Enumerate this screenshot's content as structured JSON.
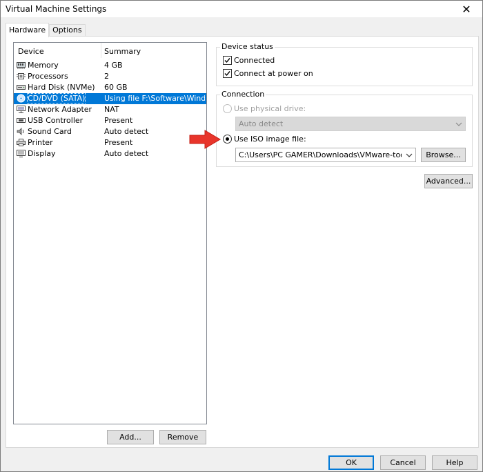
{
  "window": {
    "title": "Virtual Machine Settings",
    "close_icon": "close-icon"
  },
  "tabs": [
    {
      "label": "Hardware",
      "active": true
    },
    {
      "label": "Options",
      "active": false
    }
  ],
  "device_list": {
    "columns": [
      "Device",
      "Summary"
    ],
    "rows": [
      {
        "name": "Memory",
        "summary": "4 GB",
        "icon": "memory-icon",
        "selected": false
      },
      {
        "name": "Processors",
        "summary": "2",
        "icon": "processor-icon",
        "selected": false
      },
      {
        "name": "Hard Disk (NVMe)",
        "summary": "60 GB",
        "icon": "hard-disk-icon",
        "selected": false
      },
      {
        "name": "CD/DVD (SATA)",
        "summary": "Using file F:\\Software\\Windo...",
        "icon": "cd-dvd-icon",
        "selected": true
      },
      {
        "name": "Network Adapter",
        "summary": "NAT",
        "icon": "network-adapter-icon",
        "selected": false
      },
      {
        "name": "USB Controller",
        "summary": "Present",
        "icon": "usb-icon",
        "selected": false
      },
      {
        "name": "Sound Card",
        "summary": "Auto detect",
        "icon": "sound-card-icon",
        "selected": false
      },
      {
        "name": "Printer",
        "summary": "Present",
        "icon": "printer-icon",
        "selected": false
      },
      {
        "name": "Display",
        "summary": "Auto detect",
        "icon": "display-icon",
        "selected": false
      }
    ]
  },
  "list_buttons": {
    "add": "Add...",
    "remove": "Remove"
  },
  "device_status": {
    "label": "Device status",
    "connected": {
      "label": "Connected",
      "checked": true
    },
    "connect_at_power_on": {
      "label": "Connect at power on",
      "checked": true
    }
  },
  "connection": {
    "label": "Connection",
    "physical_drive": {
      "label": "Use physical drive:",
      "selected": false,
      "enabled": false
    },
    "physical_drive_select": {
      "value": "Auto detect"
    },
    "iso_image": {
      "label": "Use ISO image file:",
      "selected": true
    },
    "iso_path": {
      "value": "C:\\Users\\PC GAMER\\Downloads\\VMware-tools-wind"
    },
    "browse": "Browse..."
  },
  "advanced": "Advanced...",
  "footer": {
    "ok": "OK",
    "cancel": "Cancel",
    "help": "Help"
  },
  "colors": {
    "selection": "#0078d7",
    "arrow": "#e8352b"
  }
}
